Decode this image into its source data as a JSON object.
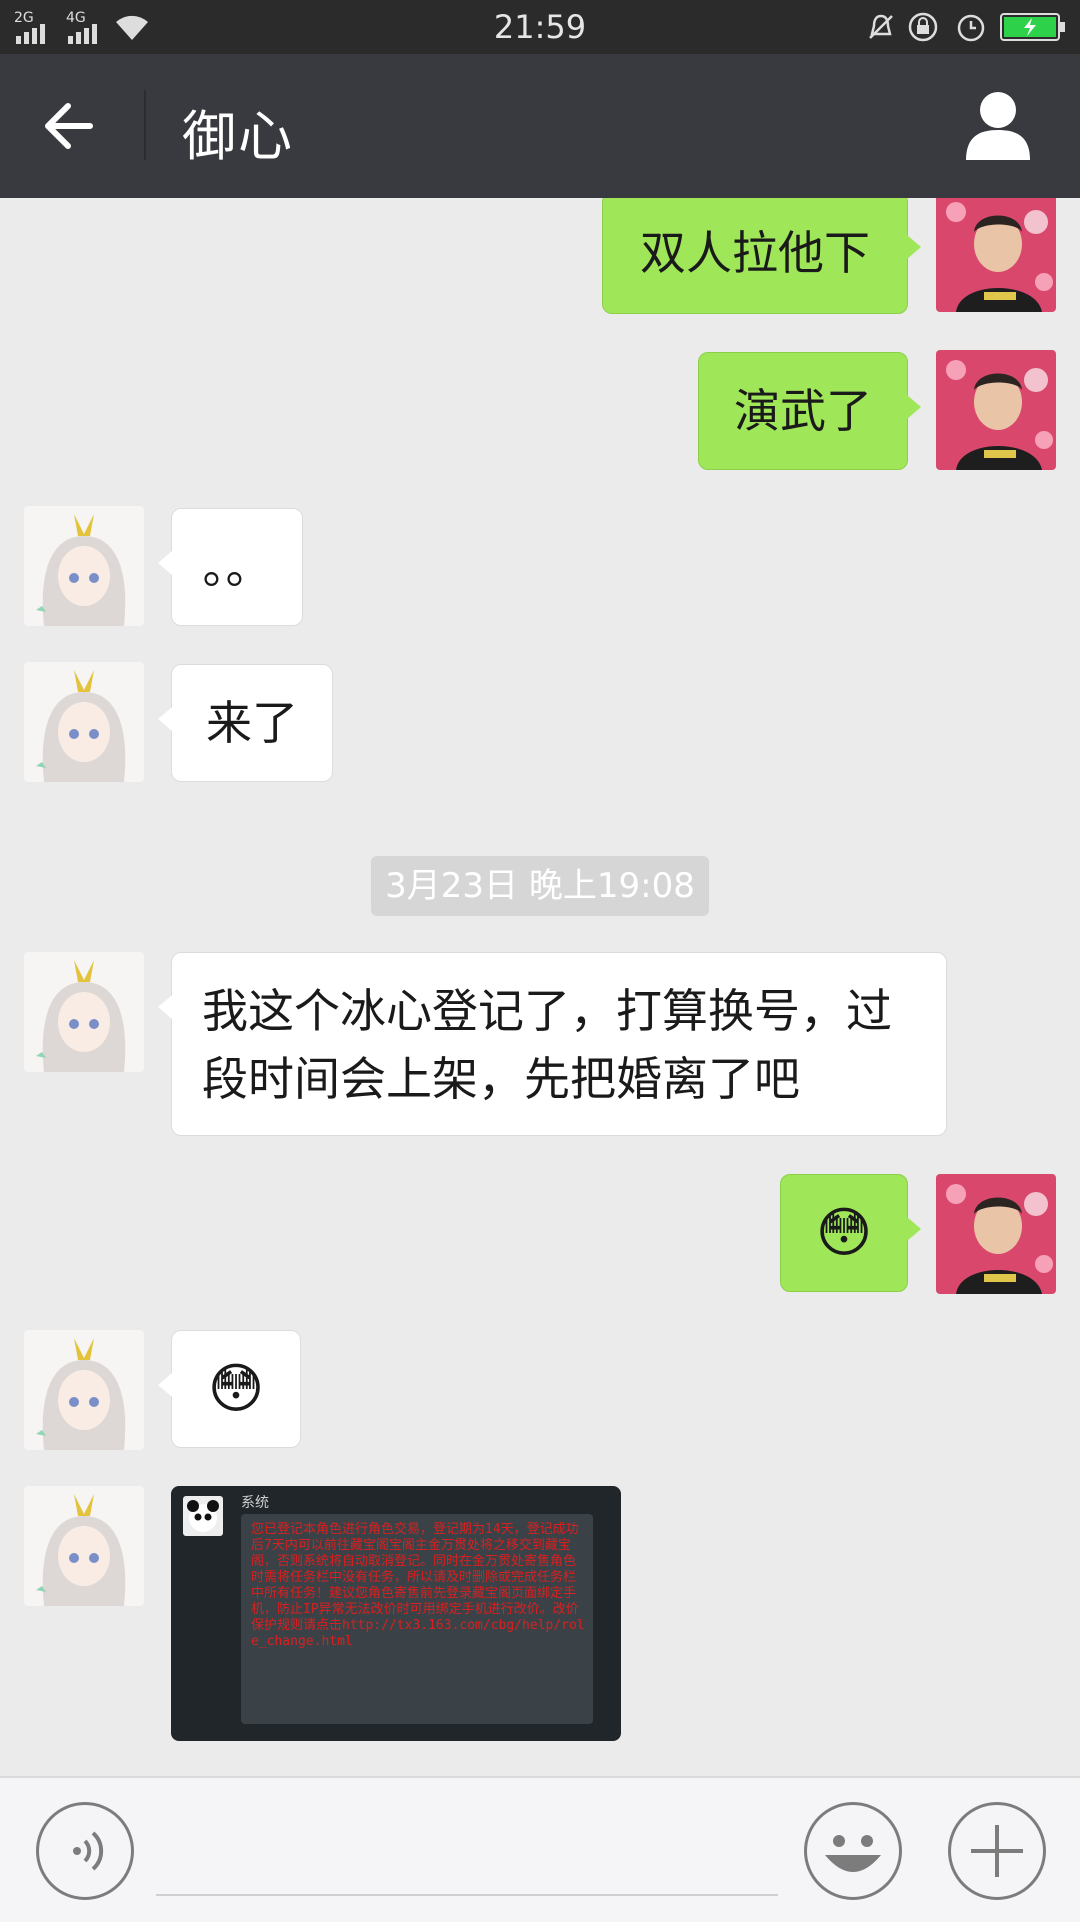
{
  "status_bar": {
    "signal_1": "2G",
    "signal_2": "4G",
    "time": "21:59",
    "icons": [
      "mute-bell-icon",
      "lock-rotation-icon",
      "alarm-icon",
      "battery-charging-icon"
    ]
  },
  "header": {
    "title": "御心",
    "back_icon": "arrow-left-icon",
    "profile_icon": "person-icon"
  },
  "messages": [
    {
      "side": "out",
      "text": "双人拉他下"
    },
    {
      "side": "out",
      "text": "演武了"
    },
    {
      "side": "in",
      "text": "。。"
    },
    {
      "side": "in",
      "text": "来了"
    },
    {
      "timestamp": "3月23日 晚上19:08"
    },
    {
      "side": "in",
      "text": "我这个冰心登记了，打算换号，过段时间会上架，先把婚离了吧"
    },
    {
      "side": "out",
      "text": "😳"
    },
    {
      "side": "in",
      "text": "😳"
    },
    {
      "side": "in",
      "image": {
        "sender": "系统",
        "text": "您已登记本角色进行角色交易，登记期为14天，登记成功后7天内可以前往藏宝阁宝阁主金万贯处将之移交到藏宝阁，否则系统将自动取消登记。同时在金万贯处寄售角色时需将任务栏中没有任务，所以请及时删除或完成任务栏中所有任务！建议您角色寄售前先登录藏宝阁页面绑定手机，防止IP异常无法改价时可用绑定手机进行改价。改价保护规则请点击http://tx3.163.com/cbg/help/role_change.html"
      }
    }
  ],
  "input_bar": {
    "voice_icon": "voice-icon",
    "emoji_icon": "smiley-icon",
    "plus_icon": "plus-icon"
  },
  "colors": {
    "titlebar": "#393a3f",
    "outgoing_bubble": "#9fe658",
    "incoming_bubble": "#ffffff",
    "background": "#ebebeb"
  }
}
